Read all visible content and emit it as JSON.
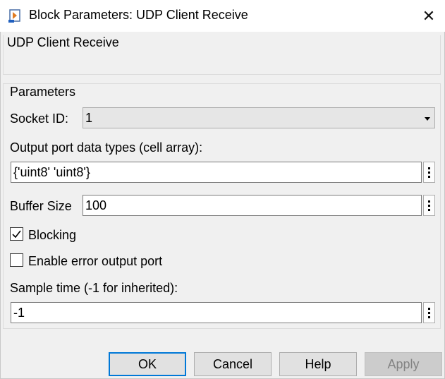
{
  "window": {
    "title": "Block Parameters: UDP Client Receive",
    "close_glyph": "✕"
  },
  "block_group": {
    "title": "UDP Client Receive"
  },
  "parameters": {
    "title": "Parameters",
    "socket_id_label": "Socket ID:",
    "socket_id_value": "1",
    "output_types_label": "Output port data types (cell array):",
    "output_types_value": "{'uint8' 'uint8'}",
    "buffer_size_label": "Buffer Size",
    "buffer_size_value": "100",
    "blocking_label": "Blocking",
    "blocking_checked": true,
    "error_port_label": "Enable error output port",
    "error_port_checked": false,
    "sample_time_label": "Sample time (-1 for inherited):",
    "sample_time_value": "-1"
  },
  "buttons": {
    "ok": "OK",
    "cancel": "Cancel",
    "help": "Help",
    "apply": "Apply"
  },
  "colors": {
    "accent": "#0078d7",
    "background": "#f0f0f0",
    "disabled_text": "#838383"
  },
  "icons": {
    "app": "simulink-block-icon",
    "close": "close-icon",
    "dropdown": "chevron-down-icon",
    "more": "kebab-menu-icon",
    "check": "checkmark-icon"
  }
}
